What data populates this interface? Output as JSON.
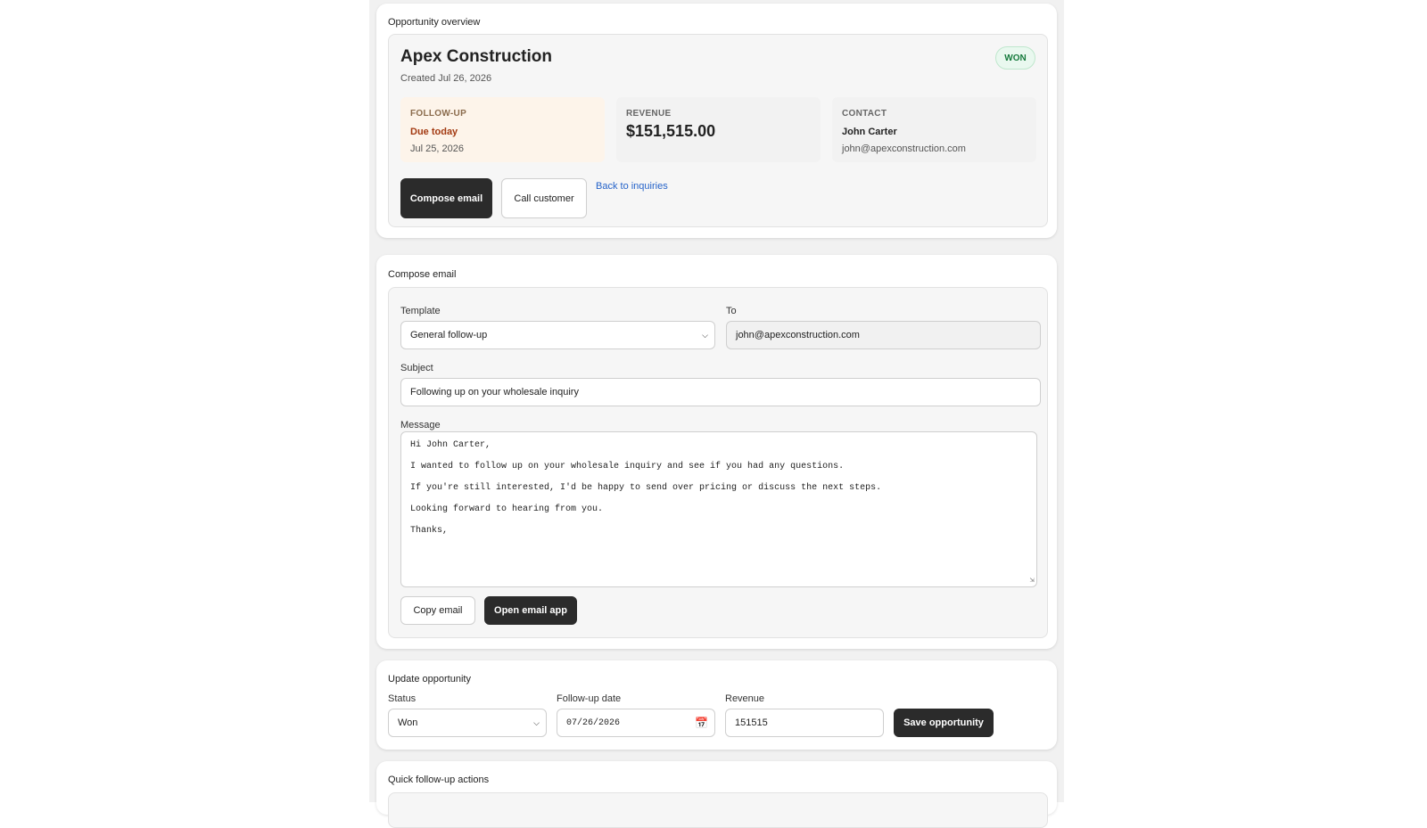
{
  "overview": {
    "section_title": "Opportunity overview",
    "company": "Apex Construction",
    "created": "Created Jul 26, 2026",
    "status_badge": "WON",
    "followup": {
      "label": "FOLLOW-UP",
      "due": "Due today",
      "date": "Jul 25, 2026"
    },
    "revenue": {
      "label": "REVENUE",
      "value": "$151,515.00"
    },
    "contact": {
      "label": "CONTACT",
      "name": "John Carter",
      "email": "john@apexconstruction.com"
    },
    "actions": {
      "compose": "Compose email",
      "call": "Call customer",
      "back": "Back to inquiries"
    }
  },
  "compose": {
    "section_title": "Compose email",
    "template_label": "Template",
    "template_value": "General follow-up",
    "to_label": "To",
    "to_value": "john@apexconstruction.com",
    "subject_label": "Subject",
    "subject_value": "Following up on your wholesale inquiry",
    "message_label": "Message",
    "message_lines": [
      "Hi John Carter,",
      "I wanted to follow up on your wholesale inquiry and see if you had any questions.",
      "If you're still interested, I'd be happy to send over pricing or discuss the next steps.",
      "Looking forward to hearing from you.",
      "Thanks,"
    ],
    "copy_button": "Copy email",
    "open_button": "Open email app"
  },
  "update": {
    "section_title": "Update opportunity",
    "status_label": "Status",
    "status_value": "Won",
    "date_label": "Follow-up date",
    "date_value": "07/26/2026",
    "revenue_label": "Revenue",
    "revenue_value": "151515",
    "save_button": "Save opportunity"
  },
  "quick": {
    "section_title": "Quick follow-up actions"
  },
  "icons": {
    "select_caret": "chevron-down-icon",
    "calendar": "calendar-icon",
    "resize": "resize-grip-icon"
  },
  "colors": {
    "primary_button": "#2b2b2b",
    "won_badge_text": "#157a3c",
    "due_text": "#a33a12",
    "link": "#2563c9"
  }
}
